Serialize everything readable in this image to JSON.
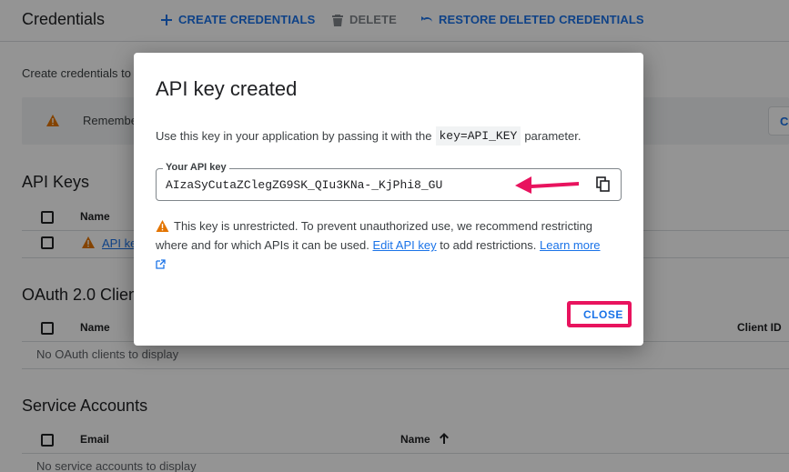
{
  "header": {
    "title": "Credentials",
    "create_label": "CREATE CREDENTIALS",
    "delete_label": "DELETE",
    "restore_label": "RESTORE DELETED CREDENTIALS"
  },
  "intro_text": "Create credentials to",
  "banner": {
    "text": "Remember",
    "button_label": "C"
  },
  "api_keys": {
    "title": "API Keys",
    "col_name": "Name",
    "row_name": "API ke"
  },
  "oauth": {
    "title": "OAuth 2.0 Clien",
    "col_name": "Name",
    "col_client_id": "Client ID",
    "empty_text": "No OAuth clients to display"
  },
  "service_accounts": {
    "title": "Service Accounts",
    "col_email": "Email",
    "col_name": "Name",
    "empty_text": "No service accounts to display"
  },
  "dialog": {
    "title": "API key created",
    "desc_before": "Use this key in your application by passing it with the",
    "desc_code": "key=API_KEY",
    "desc_after": "parameter.",
    "key_label": "Your API key",
    "key_value": "AIzaSyCutaZClegZG9SK_QIu3KNa-_KjPhi8_GU",
    "warning_text": "This key is unrestricted. To prevent unauthorized use, we recommend restricting where and for which APIs it can be used.",
    "edit_link": "Edit API key",
    "after_link": "to add restrictions.",
    "learn_more": "Learn more",
    "close_label": "CLOSE"
  },
  "colors": {
    "accent": "#1a73e8",
    "highlight": "#e8135e",
    "warning": "#e37400"
  }
}
